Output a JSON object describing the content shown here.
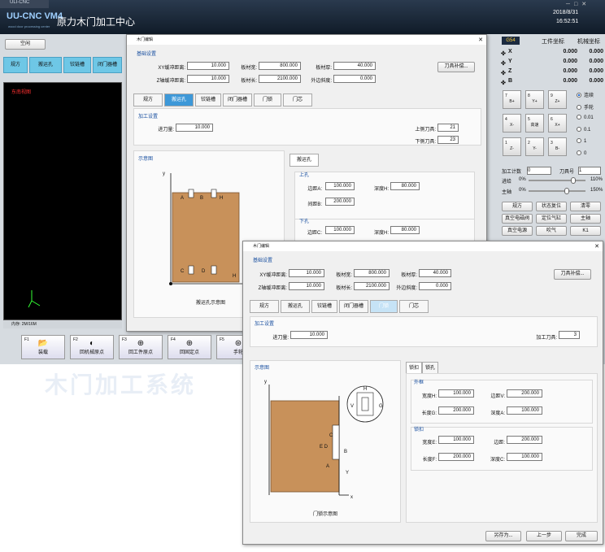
{
  "app": {
    "window_tab": "ULI-CNC",
    "logo": "UU-CNC VM4",
    "logo_sub": "wood door processing center",
    "title": "原力木门加工中心",
    "date": "2018/8/31",
    "time": "16:52:51",
    "status_button": "空闲"
  },
  "craft_tabs": [
    "规方",
    "搬运孔",
    "铰链槽",
    "闭门器槽"
  ],
  "viewport": {
    "title": "东南视图",
    "status": "内存: 2M/16M"
  },
  "fkeys": [
    {
      "fn": "F1",
      "icon": "folder-icon",
      "glyph": "📂",
      "label": "装载"
    },
    {
      "fn": "F2",
      "icon": "machine-origin-icon",
      "glyph": "◐",
      "label": "回机械原点"
    },
    {
      "fn": "F3",
      "icon": "work-origin-icon",
      "glyph": "⊕",
      "label": "回工件原点"
    },
    {
      "fn": "F4",
      "icon": "fixed-point-icon",
      "glyph": "⊕",
      "label": "回固定点"
    },
    {
      "fn": "F5",
      "icon": "handwheel-icon",
      "glyph": "⊛",
      "label": "手轮"
    }
  ],
  "coords": {
    "system": "G54",
    "work_header": "工件坐标",
    "machine_header": "机械坐标",
    "axes": [
      {
        "name": "X",
        "work": "0.000",
        "machine": "0.000"
      },
      {
        "name": "Y",
        "work": "0.000",
        "machine": "0.000"
      },
      {
        "name": "Z",
        "work": "0.000",
        "machine": "0.000"
      },
      {
        "name": "B",
        "work": "0.000",
        "machine": "0.000"
      }
    ]
  },
  "jog": [
    {
      "n": "7",
      "l": "B+"
    },
    {
      "n": "8",
      "l": "Y+"
    },
    {
      "n": "9",
      "l": "Z+"
    },
    {
      "n": "4",
      "l": "X-"
    },
    {
      "n": "5",
      "l": "高速"
    },
    {
      "n": "6",
      "l": "X+"
    },
    {
      "n": "1",
      "l": "Z-"
    },
    {
      "n": "2",
      "l": "Y-"
    },
    {
      "n": "3",
      "l": "B-"
    }
  ],
  "modes": [
    {
      "label": "连续",
      "on": true
    },
    {
      "label": "手轮"
    },
    {
      "label": "0.01"
    },
    {
      "label": "0.1"
    },
    {
      "label": "1"
    },
    {
      "label": "0"
    }
  ],
  "counters": {
    "piece_label": "加工计数",
    "piece_value": "0",
    "tool_label": "刀具号",
    "tool_value": "1",
    "feed_label": "进给",
    "feed_min": "0%",
    "feed_max": "110%",
    "spindle_label": "主轴",
    "spindle_min": "0%",
    "spindle_max": "150%"
  },
  "ops": [
    "规方",
    "状态复位",
    "清零",
    "真空电磁阀",
    "定位气缸",
    "主轴",
    "真空电源",
    "吹气",
    "K1"
  ],
  "dlg1": {
    "title": "木门编辑",
    "base_section": "基础设置",
    "xy_buf_label": "XY缓冲距离:",
    "xy_buf": "10.000",
    "board_w_label": "板材宽:",
    "board_w": "800.000",
    "board_t_label": "板材厚:",
    "board_t": "40.000",
    "z_buf_label": "Z轴缓冲距离:",
    "z_buf": "10.000",
    "board_l_label": "板材长:",
    "board_l": "2100.000",
    "outer_slope_label": "外边斜度:",
    "outer_slope": "0.000",
    "comp_button": "刀具补偿...",
    "tabs": [
      "规方",
      "搬运孔",
      "铰链槽",
      "闭门器槽",
      "门锁",
      "门芯"
    ],
    "proc_section": "加工设置",
    "feed_label": "进刀量:",
    "feed": "10.000",
    "upper_tool_label": "上侧刀具:",
    "upper_tool": "21",
    "lower_tool_label": "下侧刀具:",
    "lower_tool": "23",
    "diagram_section": "示意图",
    "subtab": "搬运孔",
    "upper_hole": "上孔",
    "edge_a_label": "边距A:",
    "edge_a": "100.000",
    "depth_h_label": "深度H:",
    "depth_h": "80.000",
    "gap_b_label": "间距B:",
    "gap_b": "200.000",
    "lower_hole": "下孔",
    "edge_c_label": "边距C:",
    "edge_c": "100.000",
    "depth_h2": "80.000",
    "caption": "搬运孔示意图",
    "axis_x": "x",
    "axis_y": "y"
  },
  "dlg2": {
    "title": "木门编辑",
    "base_section": "基础设置",
    "xy_buf_label": "XY缓冲距离:",
    "xy_buf": "10.000",
    "board_w_label": "板材宽:",
    "board_w": "800.000",
    "board_t_label": "板材厚:",
    "board_t": "40.000",
    "z_buf_label": "Z轴缓冲距离:",
    "z_buf": "10.000",
    "board_l_label": "板材长:",
    "board_l": "2100.000",
    "outer_slope_label": "外边斜度:",
    "outer_slope": "0.000",
    "comp_button": "刀具补偿...",
    "tabs": [
      "规方",
      "搬运孔",
      "铰链槽",
      "闭门器槽",
      "门锁",
      "门芯"
    ],
    "proc_section": "加工设置",
    "feed_label": "进刀量:",
    "feed": "10.000",
    "tool_label": "加工刀具:",
    "tool": "3",
    "diagram_section": "示意图",
    "subtabs": [
      "锁扣",
      "锁孔"
    ],
    "frame_section": "外框",
    "width_h_label": "宽度H:",
    "width_h": "100.000",
    "edge_v_label": "边距V:",
    "edge_v": "200.000",
    "length_g_label": "长度G:",
    "length_g": "200.000",
    "depth_a_label": "深度A:",
    "depth_a": "100.000",
    "hole_section": "锁扣",
    "width_e_label": "宽度E:",
    "width_e": "100.000",
    "edge_d_label": "边距:",
    "edge_d": "200.000",
    "length_f_label": "长度F:",
    "length_f": "200.000",
    "depth_c_label": "深度C:",
    "depth_c": "100.000",
    "caption": "门锁示意图",
    "axis_x": "x",
    "axis_y": "y",
    "save_as": "另存为...",
    "prev": "上一步",
    "finish": "完成"
  }
}
